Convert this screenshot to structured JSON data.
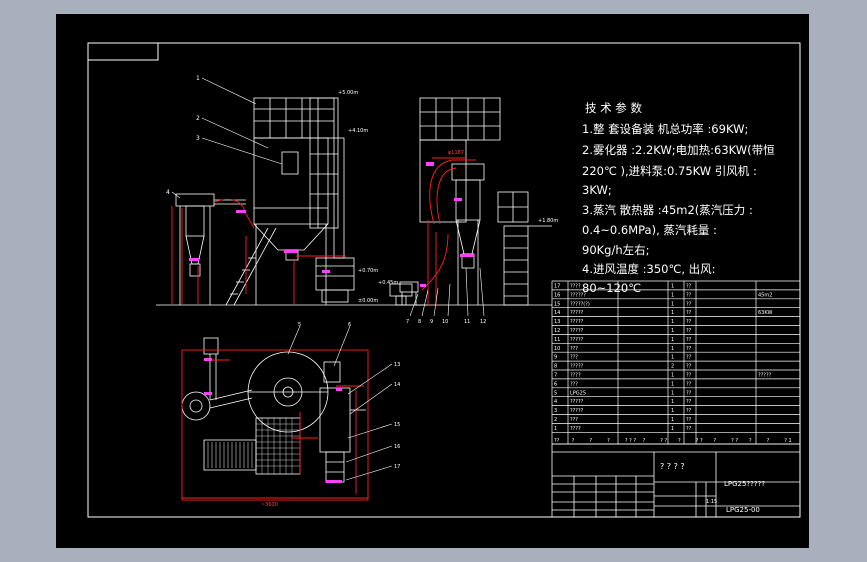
{
  "notes": {
    "heading": "技 术 参 数",
    "line1": "1.整 套设备装 机总功率 :69KW;",
    "line2": "2.雾化器 :2.2KW;电加热:63KW(带恒",
    "line3": "220℃ ),进料泵:0.75KW   引风机 :",
    "line4": "3KW;",
    "line5": "3.蒸汽 散热器 :45m2(蒸汽压力 :",
    "line6": "0.4~0.6MPa), 蒸汽耗量 :",
    "line7": "90Kg/h左右;",
    "line8": "4.进风温度 :350℃, 出风:",
    "line9": "80~120℃"
  },
  "title_block": {
    "drawing_title": "? ? ? ?",
    "product_name": "LPG25?????",
    "drawing_number": "LPG25-00",
    "scale": "1:15",
    "header_cells": [
      "??",
      "?",
      "?",
      "?",
      "? ? ?",
      "?",
      "? ?",
      "?",
      "? ?",
      "?",
      "? ?",
      "?",
      "?",
      "? 1"
    ]
  },
  "bom": {
    "rows": [
      {
        "no": "17",
        "name": "????",
        "qty": "1",
        "mat": "??",
        "note": ""
      },
      {
        "no": "16",
        "name": "??????",
        "qty": "1",
        "mat": "??",
        "note": "45m2"
      },
      {
        "no": "15",
        "name": "?????(?)",
        "qty": "1",
        "mat": "??",
        "note": ""
      },
      {
        "no": "14",
        "name": "?????",
        "qty": "1",
        "mat": "??",
        "note": "63KW"
      },
      {
        "no": "13",
        "name": "?????",
        "qty": "1",
        "mat": "??",
        "note": ""
      },
      {
        "no": "12",
        "name": "?????",
        "qty": "1",
        "mat": "??",
        "note": ""
      },
      {
        "no": "11",
        "name": "?????",
        "qty": "1",
        "mat": "??",
        "note": ""
      },
      {
        "no": "10",
        "name": "???",
        "qty": "1",
        "mat": "??",
        "note": ""
      },
      {
        "no": "9",
        "name": "???",
        "qty": "1",
        "mat": "??",
        "note": ""
      },
      {
        "no": "8",
        "name": "?????",
        "qty": "2",
        "mat": "??",
        "note": ""
      },
      {
        "no": "7",
        "name": "????",
        "qty": "1",
        "mat": "??",
        "note": "?????"
      },
      {
        "no": "6",
        "name": "???",
        "qty": "1",
        "mat": "??",
        "note": ""
      },
      {
        "no": "5",
        "name": "LPG25",
        "qty": "1",
        "mat": "??",
        "note": ""
      },
      {
        "no": "4",
        "name": "?????",
        "qty": "1",
        "mat": "??",
        "note": ""
      },
      {
        "no": "3",
        "name": "?????",
        "qty": "1",
        "mat": "??",
        "note": ""
      },
      {
        "no": "2",
        "name": "???",
        "qty": "1",
        "mat": "??",
        "note": ""
      },
      {
        "no": "1",
        "name": "????",
        "qty": "1",
        "mat": "??",
        "note": ""
      }
    ]
  },
  "labels": {
    "elev_500": "+5.00m",
    "elev_410": "+4.10m",
    "elev_070": "+0.70m",
    "elev_045": "+0.45m",
    "elev_000": "±0.00m",
    "elev_180": "+1.80m",
    "dia_1187": "φ1187",
    "dim_3600": "~3600",
    "callouts_front": [
      "1",
      "2",
      "3",
      "4"
    ],
    "callouts_side": [
      "7",
      "8",
      "9",
      "10",
      "11",
      "12"
    ],
    "callouts_plan": [
      "5",
      "6",
      "13",
      "14",
      "15",
      "16",
      "17"
    ]
  },
  "colors": {
    "background": "#000000",
    "frame": "#ffffff",
    "dimension": "#ff2020",
    "accent": "#ff40ff",
    "equipment": "#ffffff"
  }
}
